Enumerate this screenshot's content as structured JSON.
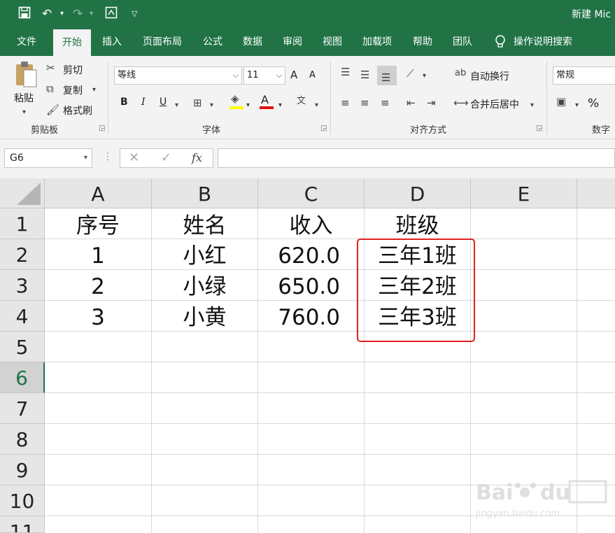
{
  "window": {
    "title": "新建 Mic"
  },
  "quick_access": {
    "save_icon": "save-icon",
    "undo_icon": "undo-icon",
    "redo_icon": "redo-icon",
    "form_icon": "form-icon",
    "customize_icon": "customize-icon"
  },
  "tabs": [
    {
      "label": "文件"
    },
    {
      "label": "开始"
    },
    {
      "label": "插入"
    },
    {
      "label": "页面布局"
    },
    {
      "label": "公式"
    },
    {
      "label": "数据"
    },
    {
      "label": "审阅"
    },
    {
      "label": "视图"
    },
    {
      "label": "加载项"
    },
    {
      "label": "帮助"
    },
    {
      "label": "团队"
    },
    {
      "label": "操作说明搜索"
    }
  ],
  "ribbon": {
    "clipboard": {
      "label": "剪贴板",
      "paste": "粘贴",
      "cut": "剪切",
      "copy": "复制",
      "format_painter": "格式刷"
    },
    "font": {
      "label": "字体",
      "font_name": "等线",
      "font_size": "11",
      "bold": "B",
      "italic": "I",
      "underline": "U",
      "grow": "A",
      "shrink": "A",
      "font_color_letter": "A"
    },
    "alignment": {
      "label": "对齐方式",
      "wrap": "自动换行",
      "merge": "合并后居中"
    },
    "number": {
      "label": "数字",
      "format": "常规",
      "percent": "%"
    }
  },
  "formula_bar": {
    "name_box": "G6",
    "fx": "fx",
    "value": ""
  },
  "grid": {
    "columns": [
      "A",
      "B",
      "C",
      "D",
      "E"
    ],
    "rows": [
      "1",
      "2",
      "3",
      "4",
      "5",
      "6",
      "7",
      "8",
      "9",
      "10",
      "11"
    ],
    "selected_row": "6",
    "cells": [
      [
        "序号",
        "姓名",
        "收入",
        "班级"
      ],
      [
        "1",
        "小红",
        "620.0",
        "三年1班"
      ],
      [
        "2",
        "小绿",
        "650.0",
        "三年2班"
      ],
      [
        "3",
        "小黄",
        "760.0",
        "三年3班"
      ]
    ]
  },
  "colors": {
    "accent": "#217346",
    "highlight_box": "#e02020"
  }
}
